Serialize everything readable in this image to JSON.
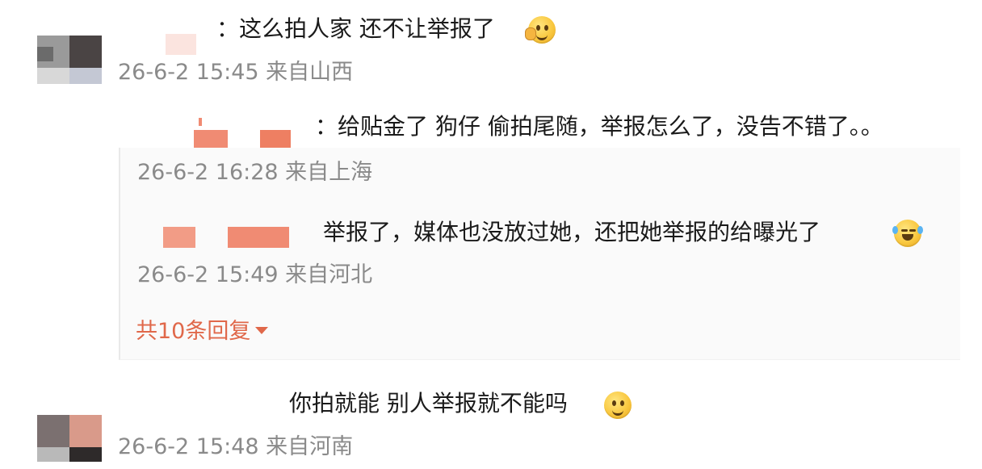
{
  "comments": [
    {
      "text": "：这么拍人家 还不让举报了",
      "meta": "26-6-2 15:45 来自山西",
      "emoji": "smirk-emoji"
    },
    {
      "text": "你拍就能 别人举报就不能吗",
      "meta": "26-6-2 15:48 来自河南",
      "emoji": "smile-emoji"
    }
  ],
  "replies": [
    {
      "text": "：给贴金了 狗仔 偷拍尾随，举报怎么了，没告不错了。。",
      "meta": "26-6-2 16:28 来自上海"
    },
    {
      "text": "举报了，媒体也没放过她，还把她举报的给曝光了",
      "meta": "26-6-2 15:49 来自河北",
      "emoji": "laugh-cry-emoji"
    }
  ],
  "more_replies": "共10条回复",
  "colors": {
    "meta": "#8a8a8a",
    "link": "#e0684a",
    "censor": "#f08b73"
  }
}
